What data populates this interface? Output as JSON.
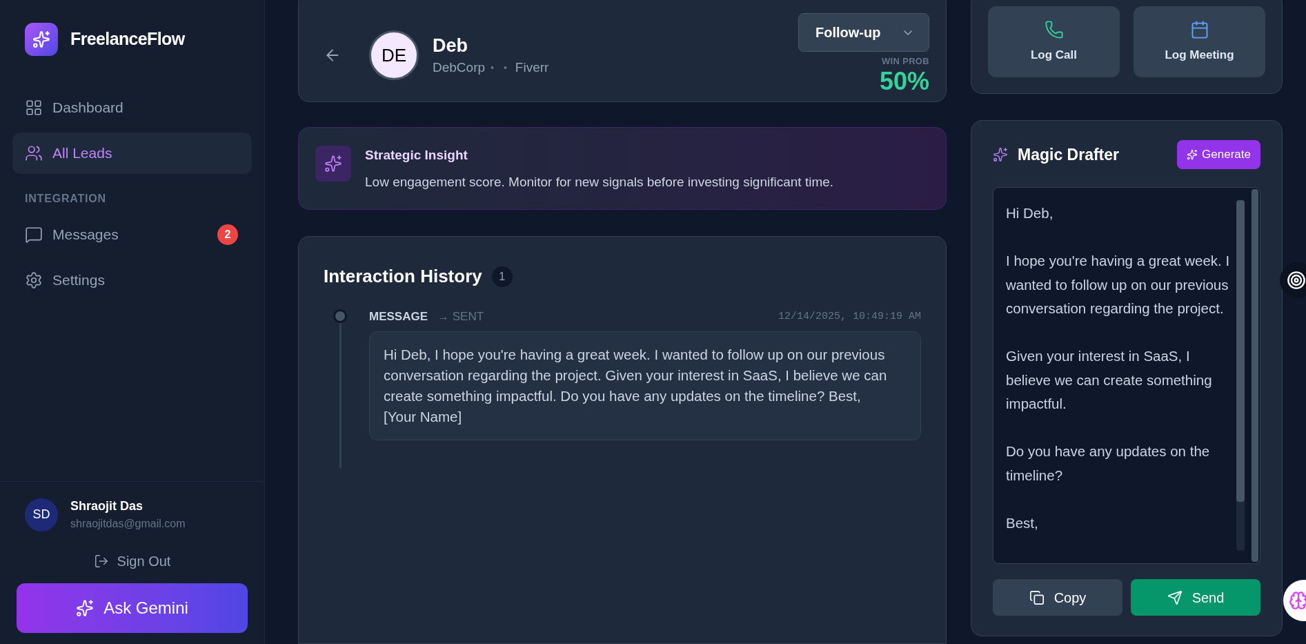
{
  "sidebar": {
    "brand": "FreelanceFlow",
    "nav": [
      {
        "label": "Dashboard",
        "selected": false
      },
      {
        "label": "All Leads",
        "selected": true
      }
    ],
    "section_label": "INTEGRATION",
    "integration": [
      {
        "label": "Messages",
        "badge": "2",
        "selected": false
      },
      {
        "label": "Settings",
        "selected": false
      }
    ],
    "user": {
      "initials": "SD",
      "name": "Shraojit Das",
      "email": "shraojitdas@gmail.com"
    },
    "sign_out": "Sign Out",
    "ask_button": "Ask Gemini"
  },
  "lead": {
    "initials": "DE",
    "name": "Deb",
    "company": "DebCorp",
    "separator_1": "•",
    "separator_2": "•",
    "source": "Fiverr",
    "stage": "Follow-up",
    "win_prob_label": "WIN PROB",
    "win_prob": "50%"
  },
  "insight": {
    "title": "Strategic Insight",
    "text": "Low engagement score. Monitor for new signals before investing significant time."
  },
  "history": {
    "title": "Interaction History",
    "count": "1",
    "items": [
      {
        "type": "MESSAGE",
        "direction": "→ SENT",
        "timestamp": "12/14/2025, 10:49:19 AM",
        "text": "Hi Deb, I hope you're having a great week. I wanted to follow up on our previous conversation regarding the project. Given your interest in SaaS, I believe we can create something impactful. Do you have any updates on the timeline? Best, [Your Name]"
      }
    ]
  },
  "quick_actions": [
    {
      "label": "Log Call"
    },
    {
      "label": "Log Meeting"
    }
  ],
  "drafter": {
    "title": "Magic Drafter",
    "generate": "Generate",
    "draft": "Hi Deb,\n\nI hope you're having a great week. I wanted to follow up on our previous conversation regarding the project.\n\nGiven your interest in SaaS, I believe we can create something impactful.\n\nDo you have any updates on the timeline?\n\nBest,",
    "copy": "Copy",
    "send": "Send"
  }
}
